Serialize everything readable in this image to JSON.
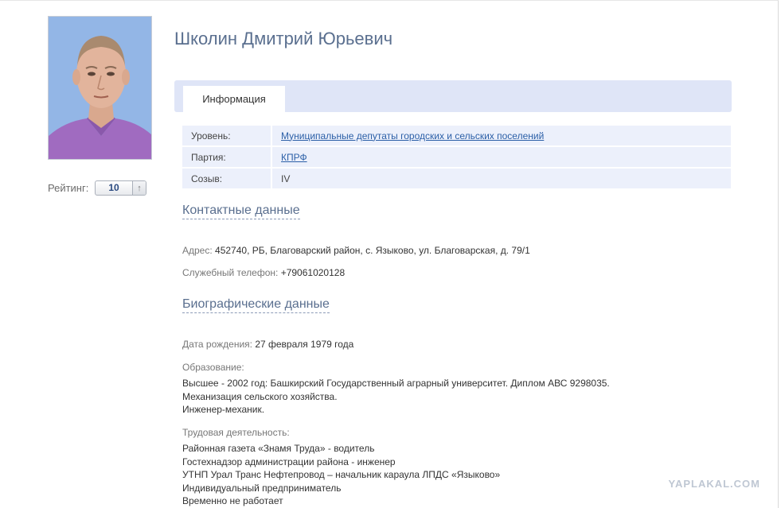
{
  "person": {
    "name": "Школин Дмитрий Юрьевич",
    "rating_label": "Рейтинг:",
    "rating_value": "10"
  },
  "tabs": [
    {
      "label": "Информация",
      "active": true
    }
  ],
  "info_rows": [
    {
      "key": "Уровень:",
      "value": "Муниципальные депутаты городских и сельских поселений",
      "link": true
    },
    {
      "key": "Партия:",
      "value": "КПРФ",
      "link": true
    },
    {
      "key": "Созыв:",
      "value": "IV",
      "link": false
    }
  ],
  "contacts": {
    "heading": "Контактные данные",
    "address_label": "Адрес:",
    "address": "452740, РБ, Благоварский район, с. Языково, ул. Благоварская, д. 79/1",
    "phone_label": "Служебный телефон:",
    "phone": "+79061020128"
  },
  "bio": {
    "heading": "Биографические данные",
    "birth_label": "Дата рождения:",
    "birth": "27 февраля 1979 года",
    "education_label": "Образование:",
    "education": [
      "Высшее - 2002 год: Башкирский Государственный аграрный университет. Диплом АВС 9298035.",
      "Механизация сельского хозяйства.",
      "Инженер-механик."
    ],
    "work_label": "Трудовая деятельность:",
    "work": [
      "Районная газета «Знамя Труда» - водитель",
      "Гостехнадзор администрации района - инженер",
      "УТНП Урал Транс Нефтепровод – начальник караула ЛПДС «Языково»",
      "Индивидуальный предприниматель",
      "Временно не работает"
    ]
  },
  "watermark": "YAPLAKAL.COM",
  "colors": {
    "accent": "#5a6f8f",
    "link": "#2b5fa7",
    "tabbar": "#dfe5f7",
    "row_bg": "#ecf0fb"
  }
}
